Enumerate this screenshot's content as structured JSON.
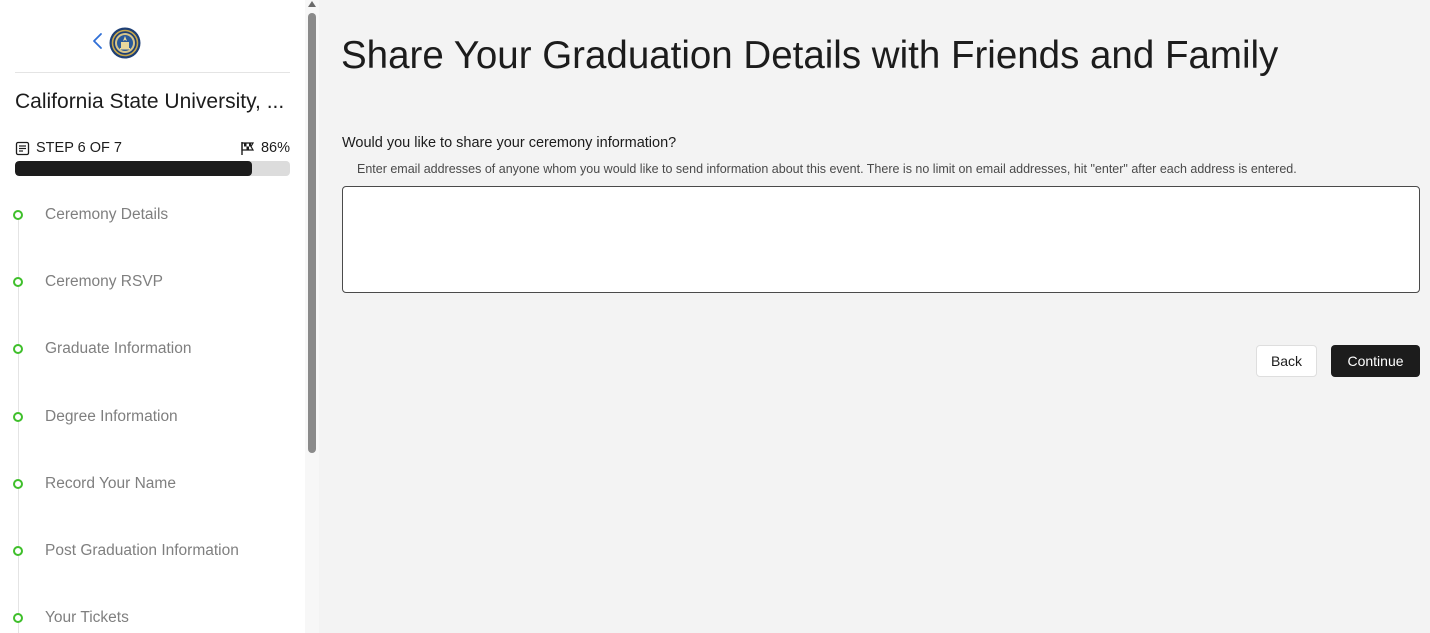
{
  "sidebar": {
    "university_name": "California State University, ...",
    "step_text": "STEP 6 OF 7",
    "percent_text": "86%",
    "progress_fraction": 0.86,
    "steps": [
      {
        "label": "Ceremony Details"
      },
      {
        "label": "Ceremony RSVP"
      },
      {
        "label": "Graduate Information"
      },
      {
        "label": "Degree Information"
      },
      {
        "label": "Record Your Name"
      },
      {
        "label": "Post Graduation Information"
      },
      {
        "label": "Your Tickets"
      }
    ]
  },
  "main": {
    "title": "Share Your Graduation Details with Friends and Family",
    "question": "Would you like to share your ceremony information?",
    "hint": "Enter email addresses of anyone whom you would like to send information about this event. There is no limit on email addresses, hit \"enter\" after each address is entered.",
    "email_value": "",
    "back_label": "Back",
    "continue_label": "Continue"
  },
  "colors": {
    "accent_dark": "#1c1c1c",
    "step_dot": "#3fbf2b",
    "background": "#f3f3f3"
  },
  "icons": {
    "back": "chevron-left-icon",
    "seal": "university-seal-icon",
    "step": "document-icon",
    "percent": "checkered-flag-icon",
    "step_marker": "circle-outline-icon"
  }
}
